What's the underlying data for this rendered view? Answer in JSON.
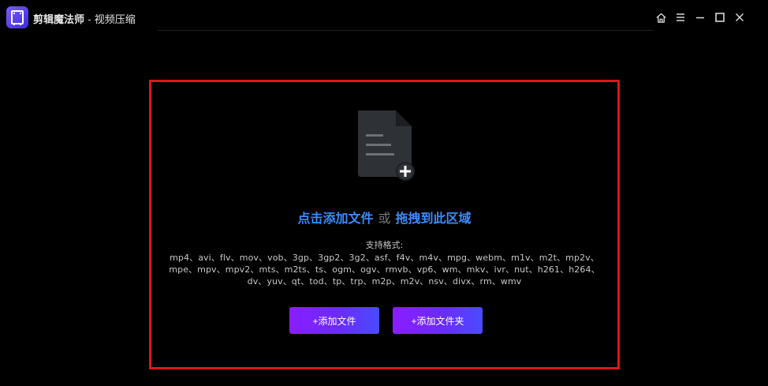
{
  "titlebar": {
    "app_name": "剪辑魔法师",
    "separator": "-",
    "page_name": "视频压缩",
    "controls": [
      "home-icon",
      "menu-icon",
      "minimize-icon",
      "maximize-icon",
      "close-icon"
    ]
  },
  "drop_zone": {
    "prompt_click": "点击添加文件",
    "prompt_or": "或",
    "prompt_drag": "拖拽到此区域",
    "formats_title": "支持格式:",
    "formats_line1": "mp4、avi、flv、mov、vob、3gp、3gp2、3g2、asf、f4v、m4v、mpg、webm、m1v、m2t、mp2v、",
    "formats_line2": "mpe、mpv、mpv2、mts、m2ts、ts、ogm、ogv、rmvb、vp6、wm、mkv、ivr、nut、h261、h264、",
    "formats_line3": "dv、yuv、qt、tod、tp、trp、m2p、m2v、nsv、divx、rm、wmv",
    "add_file_label": "+添加文件",
    "add_folder_label": "+添加文件夹"
  },
  "colors": {
    "background": "#000000",
    "link_blue": "#3b8bff",
    "highlight_border": "#e01515",
    "button_gradient_start": "#8a1dff",
    "button_gradient_end": "#4a4bff"
  }
}
